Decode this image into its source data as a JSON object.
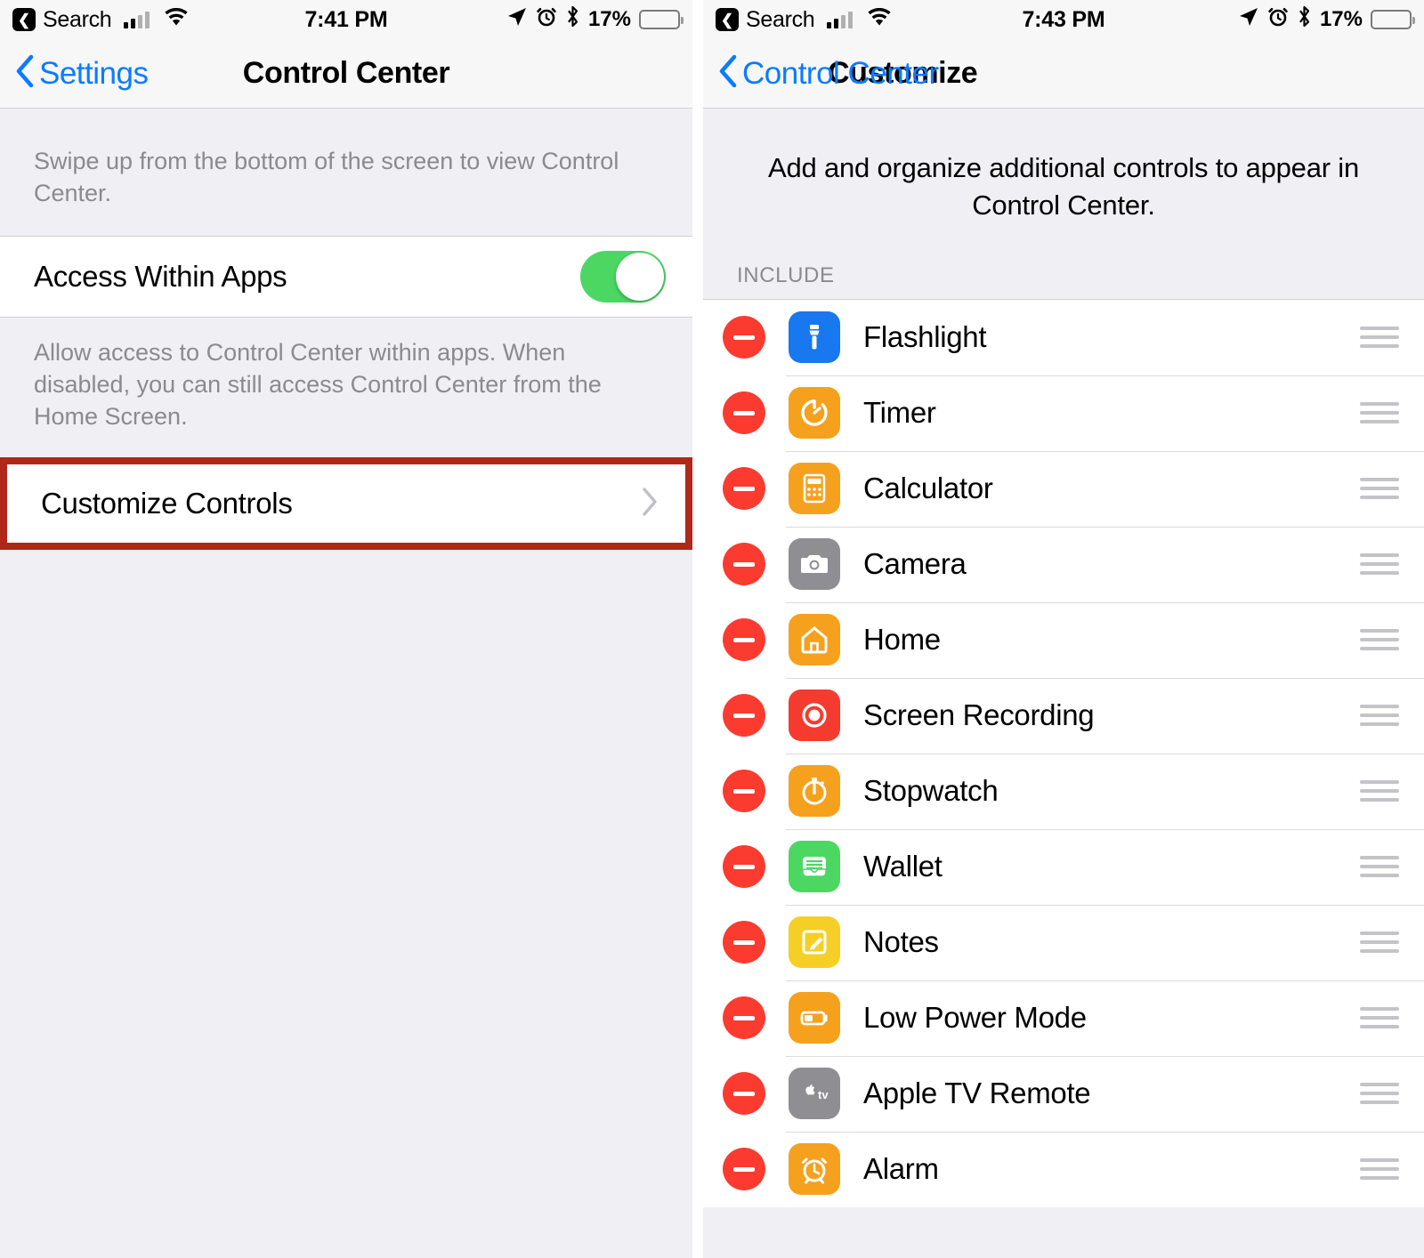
{
  "left_screen": {
    "status_bar": {
      "back_app": "Search",
      "back_icon": "back-chip-icon",
      "signal_icon": "cellular-signal-icon",
      "wifi_icon": "wifi-icon",
      "time": "7:41 PM",
      "location_icon": "location-arrow-icon",
      "alarm_icon": "alarm-clock-icon",
      "bluetooth_icon": "bluetooth-icon",
      "battery_percent": "17%",
      "battery_level": 17,
      "battery_color": "#F0433A"
    },
    "nav": {
      "back_label": "Settings",
      "back_icon": "chevron-left-icon",
      "title": "Control Center",
      "tint": "#0A7CFF"
    },
    "header_note": "Swipe up from the bottom of the screen to view Control Center.",
    "toggle_row": {
      "label": "Access Within Apps",
      "state": "on",
      "on_color": "#4CD763"
    },
    "toggle_footnote": "Allow access to Control Center within apps. When disabled, you can still access Control Center from the Home Screen.",
    "customize_row": {
      "label": "Customize Controls",
      "disclosure_icon": "chevron-right-icon",
      "highlight_color": "#B0281A"
    }
  },
  "right_screen": {
    "status_bar": {
      "back_app": "Search",
      "back_icon": "back-chip-icon",
      "signal_icon": "cellular-signal-icon",
      "wifi_icon": "wifi-icon",
      "time": "7:43 PM",
      "location_icon": "location-arrow-icon",
      "alarm_icon": "alarm-clock-icon",
      "bluetooth_icon": "bluetooth-icon",
      "battery_percent": "17%",
      "battery_level": 17,
      "battery_color": "#F0433A"
    },
    "nav": {
      "back_label": "Control Center",
      "back_icon": "chevron-left-icon",
      "title": "Customize",
      "tint": "#0A7CFF"
    },
    "intro": "Add and organize additional controls to appear in Control Center.",
    "section_label": "INCLUDE",
    "remove_icon": "minus-circle-icon",
    "reorder_icon": "drag-handle-icon",
    "items": [
      {
        "label": "Flashlight",
        "icon": "flashlight-icon",
        "icon_color": "#1878F0"
      },
      {
        "label": "Timer",
        "icon": "timer-icon",
        "icon_color": "#F5A11E"
      },
      {
        "label": "Calculator",
        "icon": "calculator-icon",
        "icon_color": "#F5A11E"
      },
      {
        "label": "Camera",
        "icon": "camera-icon",
        "icon_color": "#8E8E93"
      },
      {
        "label": "Home",
        "icon": "home-icon",
        "icon_color": "#F5A11E"
      },
      {
        "label": "Screen Recording",
        "icon": "screen-recording-icon",
        "icon_color": "#F53B30"
      },
      {
        "label": "Stopwatch",
        "icon": "stopwatch-icon",
        "icon_color": "#F5A11E"
      },
      {
        "label": "Wallet",
        "icon": "wallet-icon",
        "icon_color": "#4CD763"
      },
      {
        "label": "Notes",
        "icon": "notes-icon",
        "icon_color": "#F5CF25"
      },
      {
        "label": "Low Power Mode",
        "icon": "low-power-mode-icon",
        "icon_color": "#F5A11E"
      },
      {
        "label": "Apple TV Remote",
        "icon": "apple-tv-remote-icon",
        "icon_color": "#8E8E93"
      },
      {
        "label": "Alarm",
        "icon": "alarm-icon",
        "icon_color": "#F5A11E"
      }
    ],
    "annotation": {
      "arrow_icon": "red-arrow-left-icon",
      "arrow_color": "#C0271B",
      "points_at": "Screen Recording"
    }
  }
}
